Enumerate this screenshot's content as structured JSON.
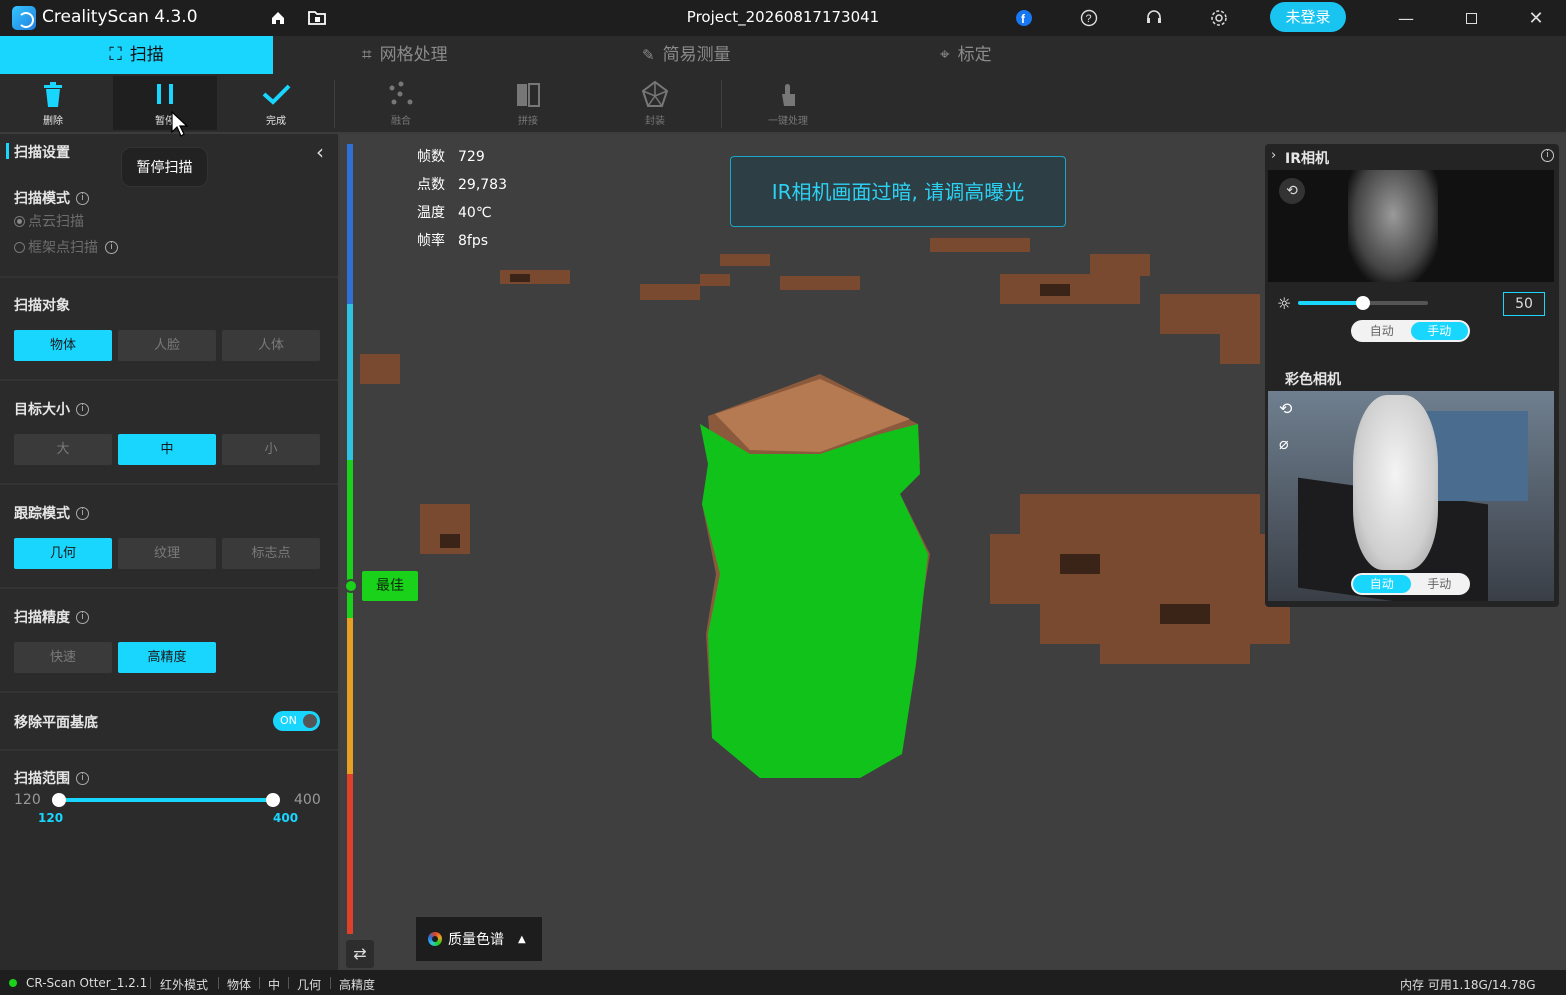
{
  "titlebar": {
    "app_name": "CrealityScan 4.3.0",
    "project": "Project_20260817173041",
    "login_label": "未登录"
  },
  "tabs": [
    {
      "label": "扫描",
      "icon": "scan-icon",
      "active": true
    },
    {
      "label": "网格处理",
      "icon": "crop-icon",
      "active": false
    },
    {
      "label": "简易测量",
      "icon": "ruler-icon",
      "active": false
    },
    {
      "label": "标定",
      "icon": "target-icon",
      "active": false
    }
  ],
  "toolbar": {
    "delete": "删除",
    "pause": "暂停",
    "done": "完成",
    "fuse": "融合",
    "stitch": "拼接",
    "mesh": "封装",
    "oneclick": "一键处理",
    "tooltip": "暂停扫描"
  },
  "sidebar": {
    "header": "扫描设置",
    "scan_mode": {
      "title": "扫描模式",
      "options": [
        "点云扫描",
        "框架点扫描"
      ],
      "selected": "点云扫描"
    },
    "scan_object": {
      "title": "扫描对象",
      "options": [
        "物体",
        "人脸",
        "人体"
      ],
      "selected": "物体"
    },
    "target_size": {
      "title": "目标大小",
      "options": [
        "大",
        "中",
        "小"
      ],
      "selected": "中"
    },
    "tracking": {
      "title": "跟踪模式",
      "options": [
        "几何",
        "纹理",
        "标志点"
      ],
      "selected": "几何"
    },
    "precision": {
      "title": "扫描精度",
      "options": [
        "快速",
        "高精度"
      ],
      "selected": "高精度"
    },
    "remove_plane": {
      "title": "移除平面基底",
      "state": "ON"
    },
    "range": {
      "title": "扫描范围",
      "min": "120",
      "max": "400",
      "low": "120",
      "high": "400"
    }
  },
  "viewport": {
    "stats": [
      {
        "k": "帧数",
        "v": "729"
      },
      {
        "k": "点数",
        "v": "29,783"
      },
      {
        "k": "温度",
        "v": "40℃"
      },
      {
        "k": "帧率",
        "v": "8fps"
      }
    ],
    "warning": "IR相机画面过暗, 请调高曝光",
    "best_label": "最佳",
    "color_map_label": "质量色谱"
  },
  "camera_panel": {
    "ir_title": "IR相机",
    "exposure_value": "50",
    "exposure_level": 0.5,
    "ir_mode": {
      "options": [
        "自动",
        "手动"
      ],
      "selected": "手动"
    },
    "color_title": "彩色相机",
    "color_mode": {
      "options": [
        "自动",
        "手动"
      ],
      "selected": "自动"
    }
  },
  "statusbar": {
    "device": "CR-Scan Otter_1.2.1",
    "mode": "红外模式",
    "object": "物体",
    "size": "中",
    "tracking": "几何",
    "precision": "高精度",
    "memory": "内存 可用1.18G/14.78G"
  },
  "colors": {
    "accent": "#19d6ff",
    "good": "#1bd21b",
    "scan_surface": "#8b5a3c"
  }
}
